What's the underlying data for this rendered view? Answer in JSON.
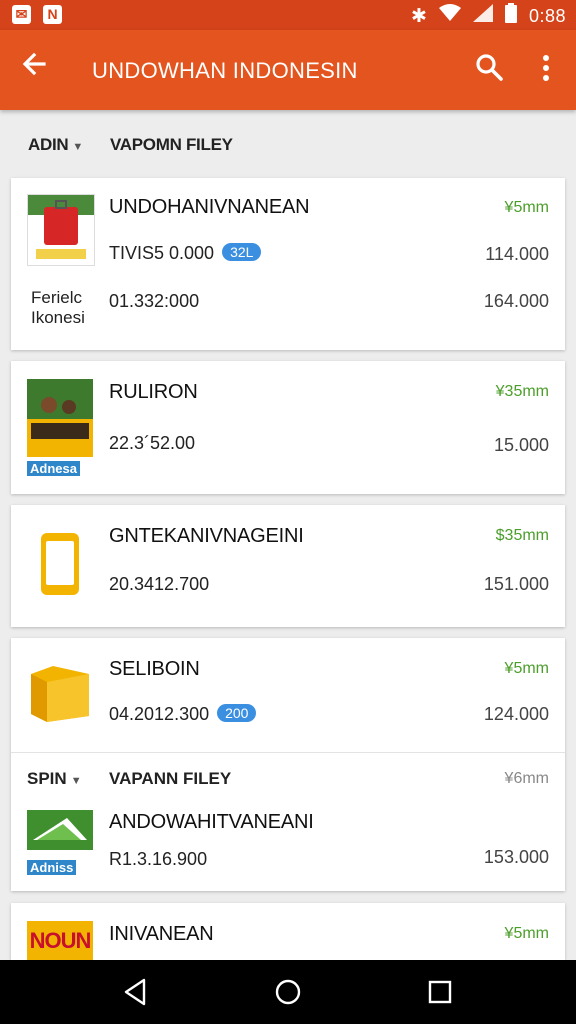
{
  "status_bar": {
    "time": "0:88"
  },
  "app_bar": {
    "title": "UNDOWHAN INDONESIN"
  },
  "filters": {
    "first": "ADIN",
    "second": "VAPOMN FILEY"
  },
  "cards": [
    {
      "title": "UNDOHANIVNANEAN",
      "tag": "¥5mm",
      "value1": "TIVIS5 0.000",
      "badge": "32L",
      "amount1": "114.000",
      "side_label": "Ferielc Ikonesi",
      "value2": "01.332:000",
      "amount2": "164.000"
    },
    {
      "title": "RULIRON",
      "tag": "¥35mm",
      "value1": "22.3´52.00",
      "amount1": "15.000",
      "brand": "Adnesa"
    },
    {
      "title": "GNTEKANIVNAGEINI",
      "tag": "$35mm",
      "value1": "20.3412.700",
      "amount1": "151.000"
    },
    {
      "title": "SELIBOIN",
      "tag": "¥5mm",
      "value1": "04.2012.300",
      "badge": "200",
      "amount1": "124.000",
      "section_first": "SPIN",
      "section_second": "VAPANN FILEY",
      "section_tag": "¥6mm",
      "sub_title": "ANDOWAHITVANEANI",
      "sub_value": "R1.3.16.900",
      "sub_amount": "153.000",
      "sub_brand": "Adniss"
    },
    {
      "title": "INIVANEAN",
      "tag": "¥5mm",
      "logo_text": "NOUN"
    }
  ],
  "colors": {
    "app_bar": "#e4541f",
    "status_bar": "#d5431a",
    "accent_green": "#4c9e2b",
    "badge_blue": "#3b8fe0"
  }
}
